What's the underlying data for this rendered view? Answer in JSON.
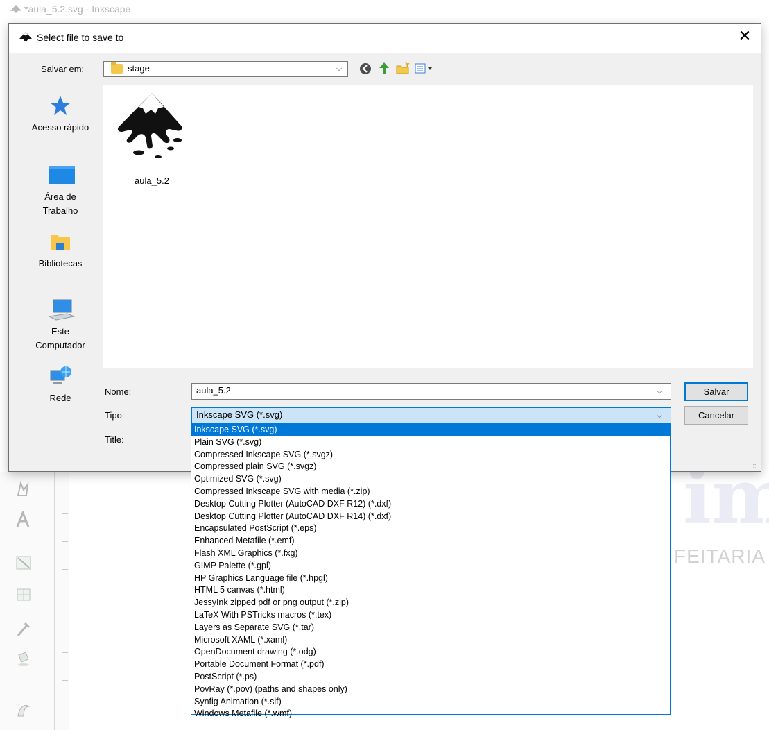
{
  "background": {
    "window_title": "*aula_5.2.svg - Inkscape",
    "brand_letters": "im",
    "brand_text": "FEITARIA"
  },
  "dialog": {
    "title": "Select file to save to",
    "save_in_label": "Salvar em:",
    "current_folder": "stage",
    "places": [
      {
        "label": "Acesso rápido",
        "icon": "star-icon"
      },
      {
        "label": "Área de Trabalho",
        "icon": "desktop-icon"
      },
      {
        "label": "Bibliotecas",
        "icon": "libraries-icon"
      },
      {
        "label": "Este Computador",
        "icon": "computer-icon"
      },
      {
        "label": "Rede",
        "icon": "network-icon"
      }
    ],
    "files": [
      {
        "name": "aula_5.2",
        "icon": "inkscape-file-icon"
      }
    ],
    "name_label": "Nome:",
    "name_value": "aula_5.2",
    "type_label": "Tipo:",
    "type_value": "Inkscape SVG (*.svg)",
    "title_label": "Title:",
    "save_button": "Salvar",
    "cancel_button": "Cancelar",
    "type_options": [
      "Inkscape SVG (*.svg)",
      "Plain SVG (*.svg)",
      "Compressed Inkscape SVG (*.svgz)",
      "Compressed plain SVG (*.svgz)",
      "Optimized SVG (*.svg)",
      "Compressed Inkscape SVG with media (*.zip)",
      "Desktop Cutting Plotter (AutoCAD DXF R12) (*.dxf)",
      "Desktop Cutting Plotter (AutoCAD DXF R14) (*.dxf)",
      "Encapsulated PostScript (*.eps)",
      "Enhanced Metafile (*.emf)",
      "Flash XML Graphics (*.fxg)",
      "GIMP Palette (*.gpl)",
      "HP Graphics Language file (*.hpgl)",
      "HTML 5 canvas (*.html)",
      "JessyInk zipped pdf or png output (*.zip)",
      "LaTeX With PSTricks macros (*.tex)",
      "Layers as Separate SVG (*.tar)",
      "Microsoft XAML (*.xaml)",
      "OpenDocument drawing (*.odg)",
      "Portable Document Format (*.pdf)",
      "PostScript (*.ps)",
      "PovRay (*.pov) (paths and shapes only)",
      "Synfig Animation (*.sif)",
      "Windows Metafile (*.wmf)"
    ],
    "selected_option_index": 0,
    "accent_color": "#0078d7"
  }
}
